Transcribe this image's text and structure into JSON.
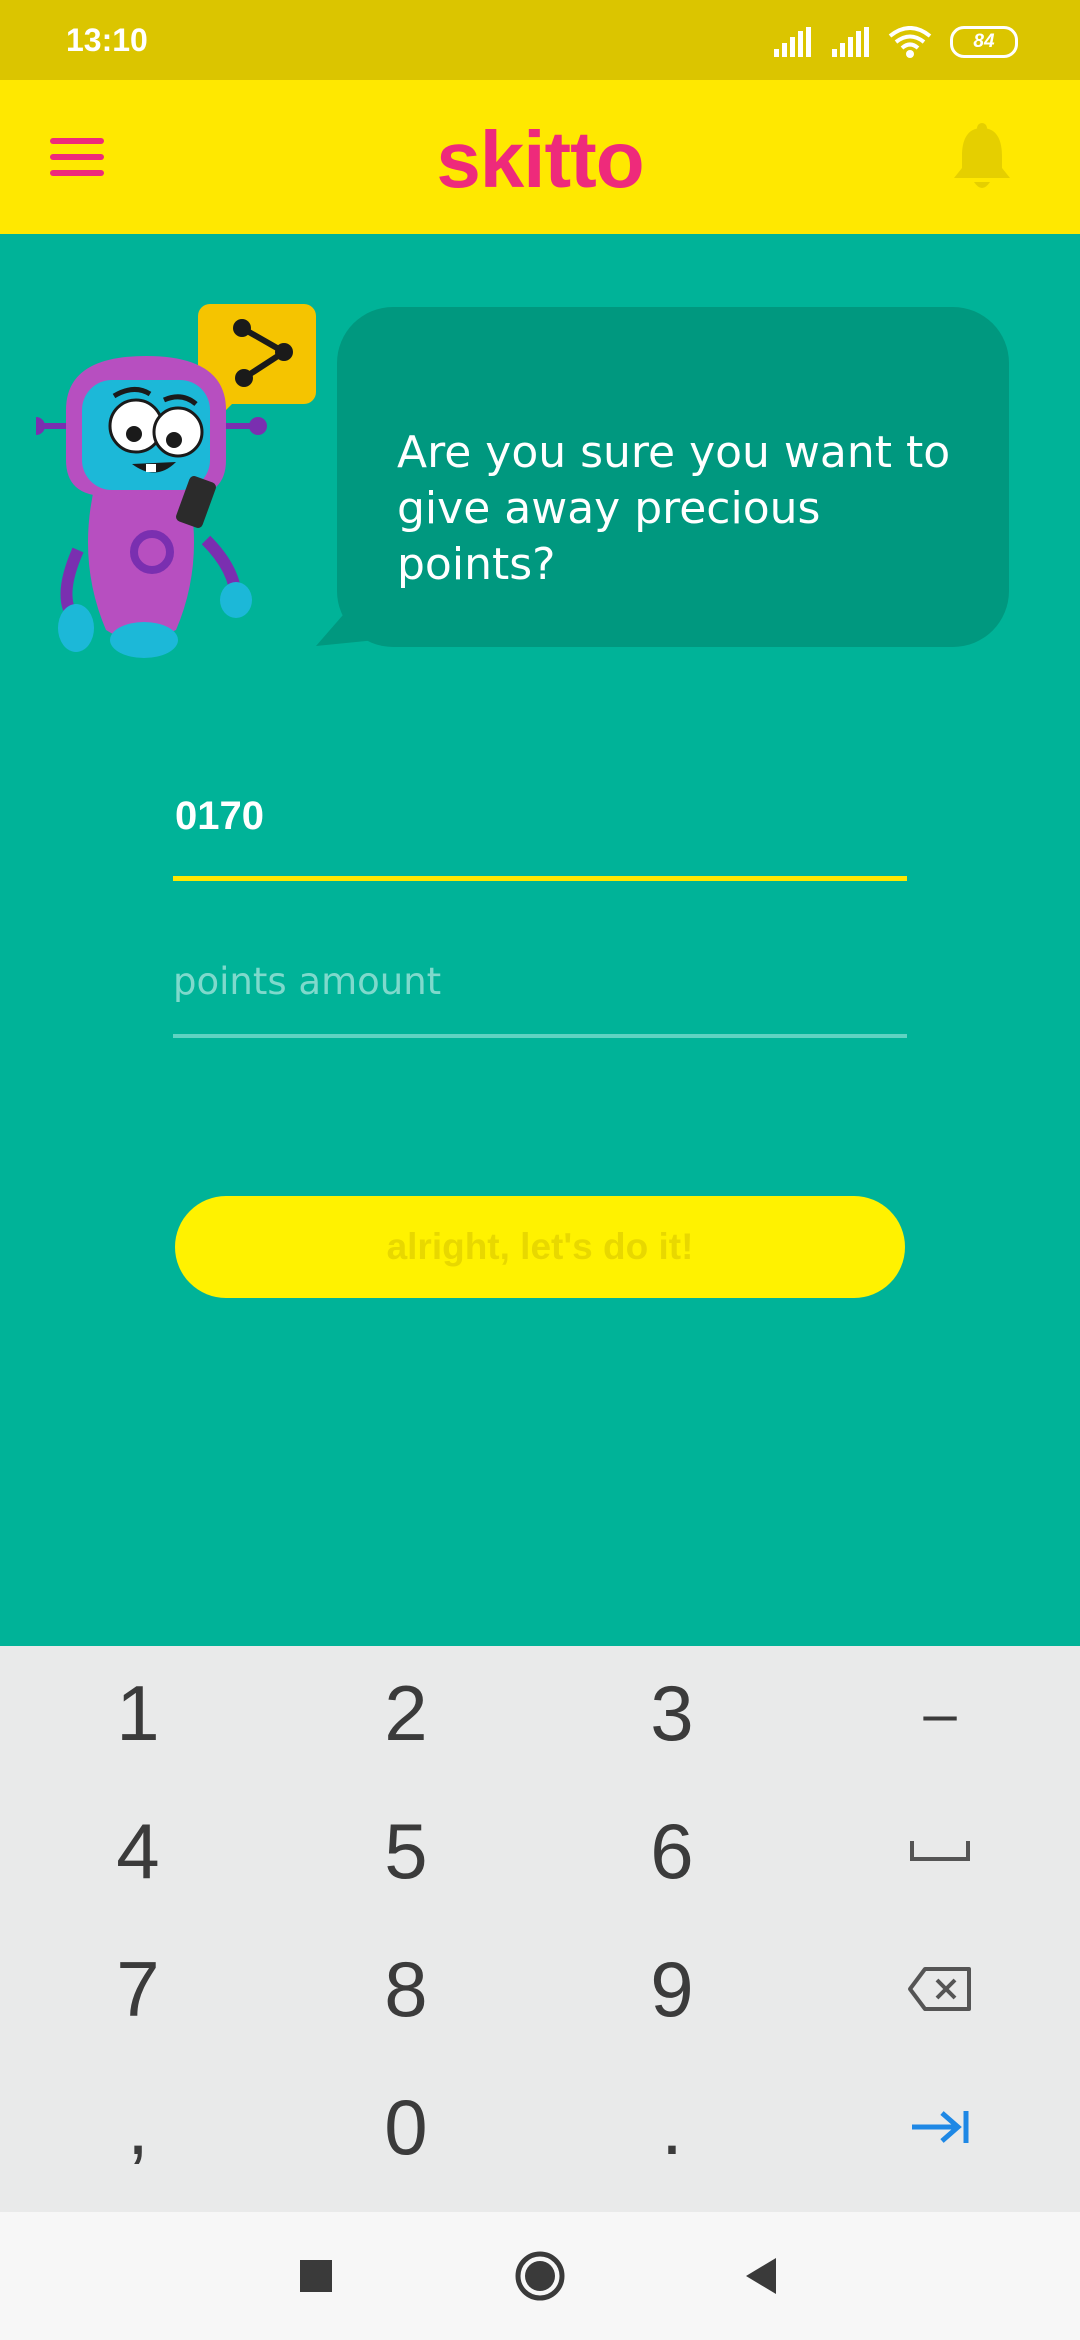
{
  "status_bar": {
    "time": "13:10",
    "battery": "84",
    "icons": [
      "signal-icon",
      "signal-icon",
      "wifi-icon",
      "battery-icon"
    ]
  },
  "app_bar": {
    "logo_text": "skitto",
    "menu_icon": "hamburger-menu-icon",
    "notification_icon": "bell-icon",
    "brand_color": "#ee2a7b",
    "background_color": "#ffe800"
  },
  "bubble": {
    "message": "Are you sure you want to give away precious points?"
  },
  "form": {
    "phone_value": "0170",
    "points_placeholder": "points amount",
    "submit_label": "alright, let's do it!"
  },
  "keyboard": {
    "keys": [
      "1",
      "2",
      "3",
      "–",
      "4",
      "5",
      "6",
      "␣",
      "7",
      "8",
      "9",
      "⌫",
      ",",
      "0",
      ".",
      "⇥"
    ]
  },
  "nav_bar": {
    "buttons": [
      "recents-square-icon",
      "home-circle-icon",
      "back-triangle-icon"
    ]
  },
  "colors": {
    "page_background": "#00b398",
    "bubble_background": "#00987f",
    "accent_yellow": "#fff200"
  }
}
